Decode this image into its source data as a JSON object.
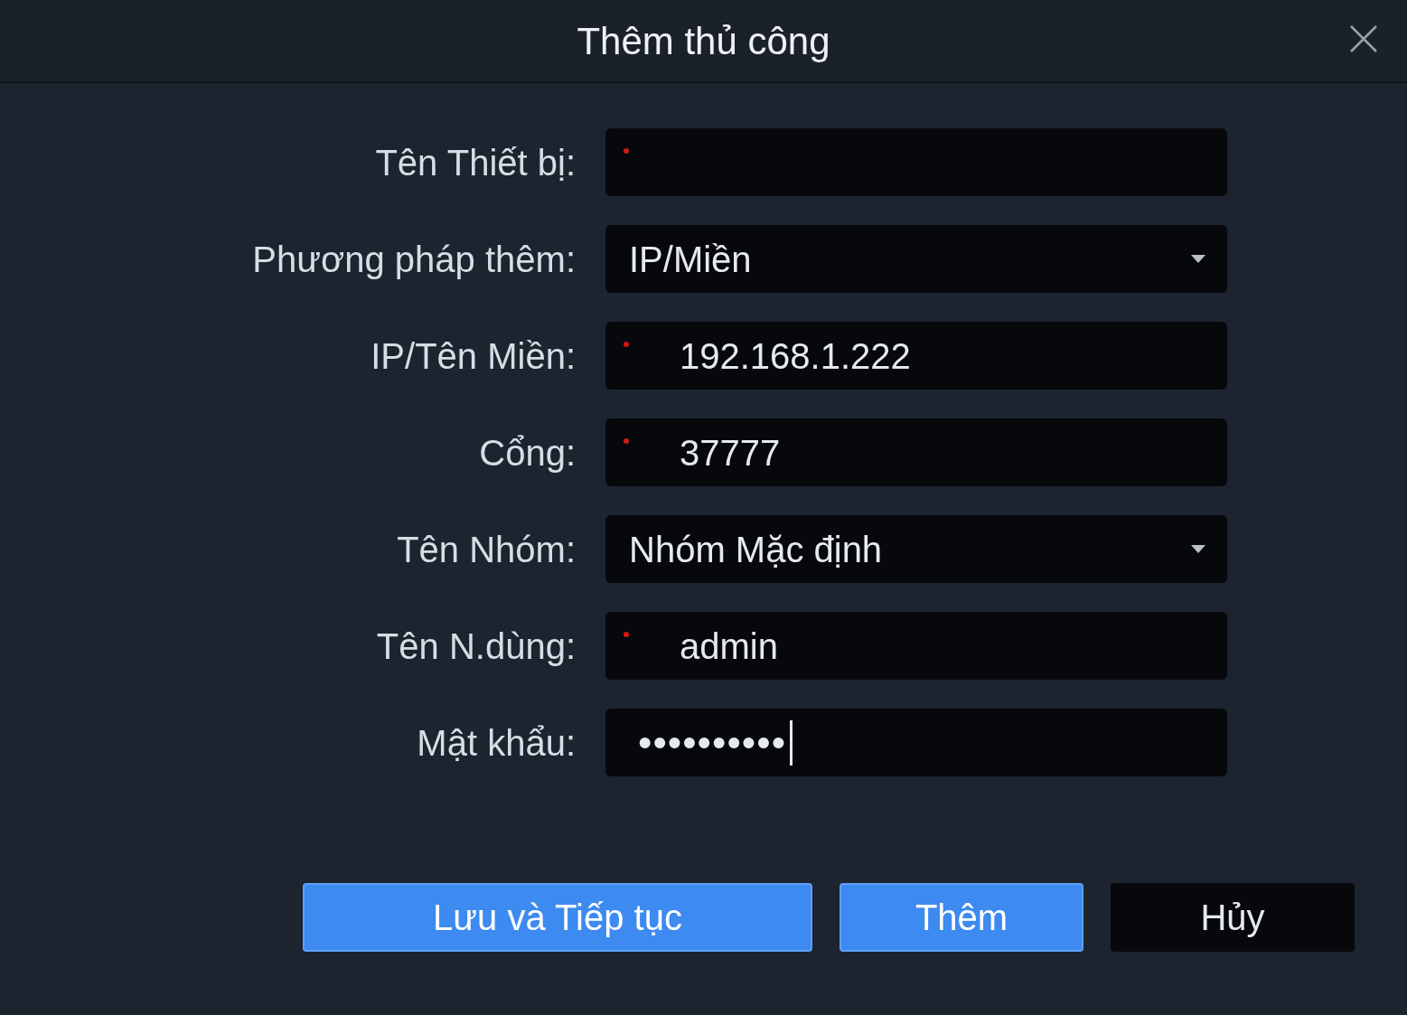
{
  "dialog": {
    "title": "Thêm thủ công"
  },
  "fields": [
    {
      "label": "Tên Thiết bị:",
      "kind": "text",
      "required": true
    },
    {
      "label": "Phương pháp thêm:",
      "kind": "select",
      "required": false,
      "value": "IP/Miền"
    },
    {
      "label": "IP/Tên Miền:",
      "kind": "text",
      "required": true,
      "value": "192.168.1.222"
    },
    {
      "label": "Cổng:",
      "kind": "text",
      "required": true,
      "value": "37777"
    },
    {
      "label": "Tên Nhóm:",
      "kind": "select",
      "required": false,
      "value": "Nhóm Mặc định"
    },
    {
      "label": "Tên N.dùng:",
      "kind": "text",
      "required": true,
      "value": "admin"
    },
    {
      "label": "Mật khẩu:",
      "kind": "password",
      "required": false,
      "value": "••••••••••",
      "focused": true
    }
  ],
  "buttons": [
    {
      "label": "Lưu và Tiếp tục",
      "primary": true
    },
    {
      "label": "Thêm",
      "primary": true
    },
    {
      "label": "Hủy",
      "primary": false
    }
  ]
}
